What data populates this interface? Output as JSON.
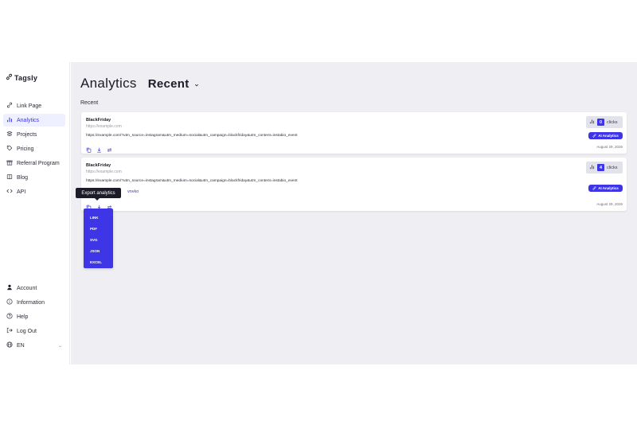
{
  "brand": {
    "name": "Tagsly",
    "accent": "#3d35e6"
  },
  "sidebar": {
    "items": [
      {
        "label": "Link Page",
        "icon": "link-icon"
      },
      {
        "label": "Analytics",
        "icon": "bar-chart-icon",
        "active": true
      },
      {
        "label": "Projects",
        "icon": "layers-icon"
      },
      {
        "label": "Pricing",
        "icon": "tag-icon"
      },
      {
        "label": "Referral Program",
        "icon": "gift-icon"
      },
      {
        "label": "Blog",
        "icon": "book-icon"
      },
      {
        "label": "API",
        "icon": "code-icon"
      }
    ],
    "bottom": [
      {
        "label": "Account",
        "icon": "user-icon"
      },
      {
        "label": "Information",
        "icon": "info-icon"
      },
      {
        "label": "Help",
        "icon": "help-icon"
      },
      {
        "label": "Log Out",
        "icon": "logout-icon"
      },
      {
        "label": "EN",
        "icon": "globe-icon"
      }
    ]
  },
  "header": {
    "title": "Analytics",
    "filter": "Recent"
  },
  "section_label": "Recent",
  "links": [
    {
      "name": "BlackFriday",
      "short_url": "https://example.com",
      "long_url": "https://example.com/?utm_source=instagram&utm_medium=social&utm_campaign=blackfriday&utm_content=instabio_event",
      "clicks": "0",
      "clicks_label": "clicks",
      "ai_label": "AI Analytics",
      "date": "August 29, 2026"
    },
    {
      "name": "BlackFriday",
      "short_url": "https://example.com",
      "long_url": "https://example.com/?utm_source=instagram&utm_medium=social&utm_campaign=blackfriday&utm_content=instabio_event",
      "partial_link": "vnvko",
      "clicks": "4",
      "clicks_label": "clicks",
      "ai_label": "AI Analytics",
      "date": "August 29, 2026"
    }
  ],
  "tooltip": "Export analytics",
  "export_options": [
    "LINK",
    "PDF",
    "SVG",
    "JSON",
    "EXCEL"
  ]
}
